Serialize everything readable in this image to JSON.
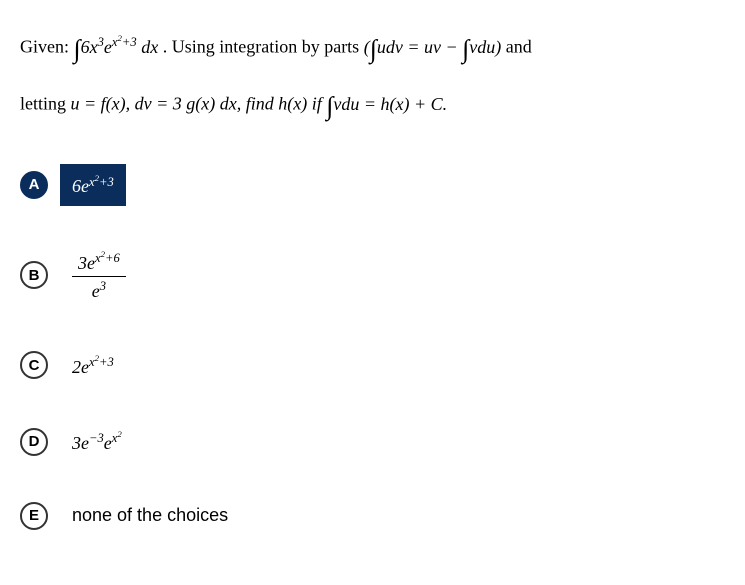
{
  "question": {
    "given_prefix": "Given: ",
    "given_expr": "∫6x³eˣ²⁺³ dx",
    "part1": ". Using integration by parts ",
    "parts_formula": "(∫udv = uv − ∫vdu)",
    "and": " and",
    "part2_prefix": "letting ",
    "let_u": "u = f(x),",
    "let_dv": " dv = 3 g(x) dx, ",
    "find_text": "find h(x) if ",
    "integral_cond": "∫vdu = h(x) + C."
  },
  "choices": {
    "A": {
      "label": "A",
      "expr": "6eˣ²⁺³",
      "selected": true
    },
    "B": {
      "label": "B",
      "num": "3eˣ²⁺⁶",
      "den": "e³",
      "selected": false
    },
    "C": {
      "label": "C",
      "expr": "2eˣ²⁺³",
      "selected": false
    },
    "D": {
      "label": "D",
      "expr": "3e⁻³eˣ²",
      "selected": false
    },
    "E": {
      "label": "E",
      "expr": "none of the choices",
      "selected": false
    }
  }
}
